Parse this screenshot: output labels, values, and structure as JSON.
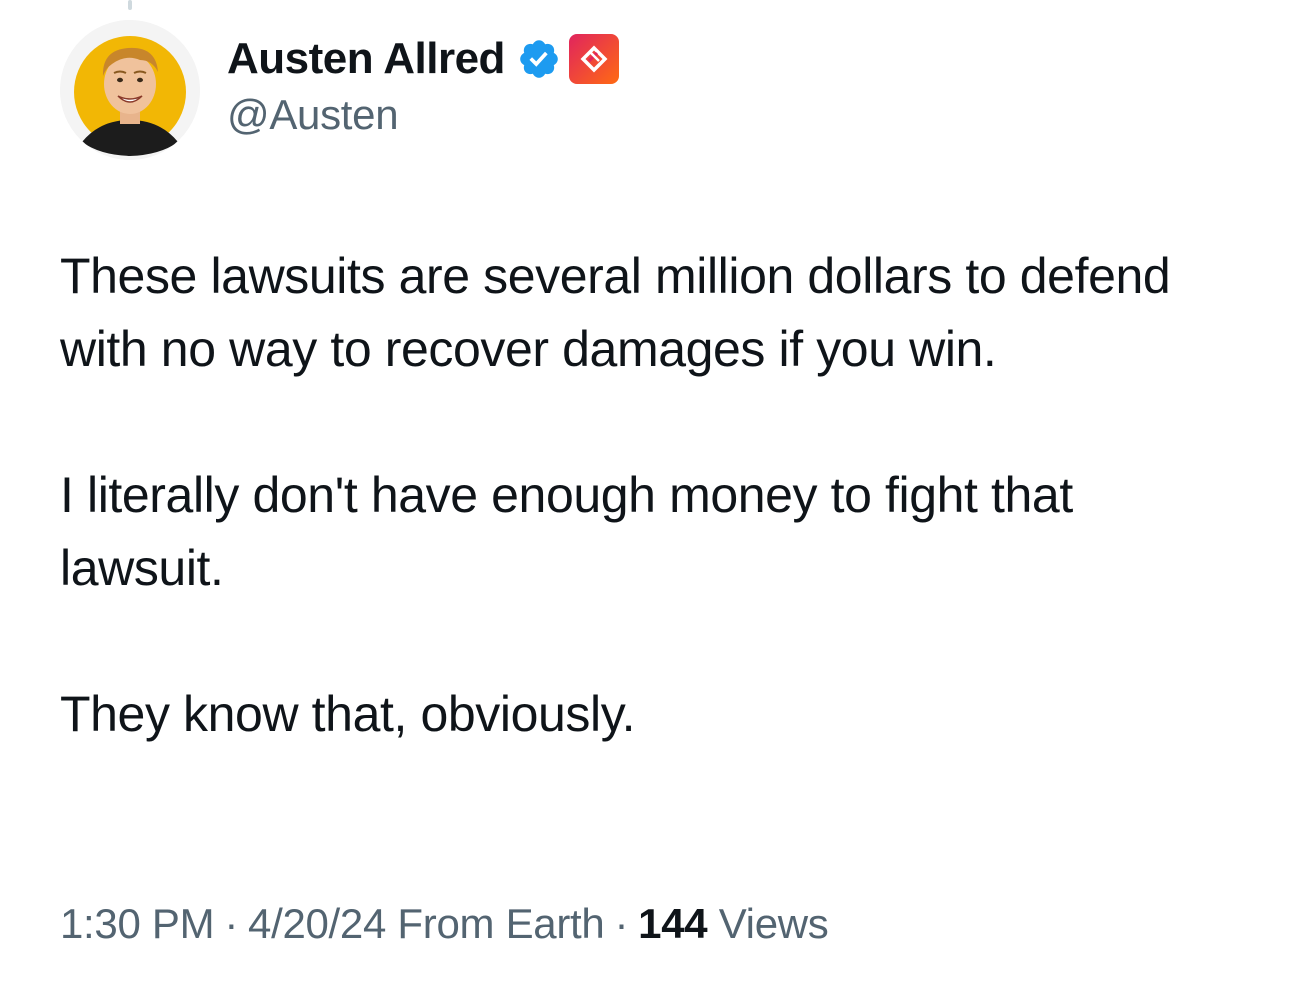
{
  "author": {
    "display_name": "Austen Allred",
    "handle": "@Austen",
    "avatar_icon": "avatar-portrait",
    "verified_icon": "verified-check-icon",
    "affiliate_icon": "affiliate-badge-icon",
    "verified_color": "#1d9bf0",
    "affiliate_colors": [
      "#e0245e",
      "#ff6a13"
    ]
  },
  "tweet": {
    "paragraphs": [
      "These lawsuits are several million dollars to defend with no way to recover damages if you win.",
      "I literally don't have enough money to fight that lawsuit.",
      "They know that, obviously."
    ]
  },
  "meta": {
    "time": "1:30 PM",
    "separator": "·",
    "date": "4/20/24",
    "location": "From Earth",
    "views_count": "144",
    "views_label": "Views"
  }
}
